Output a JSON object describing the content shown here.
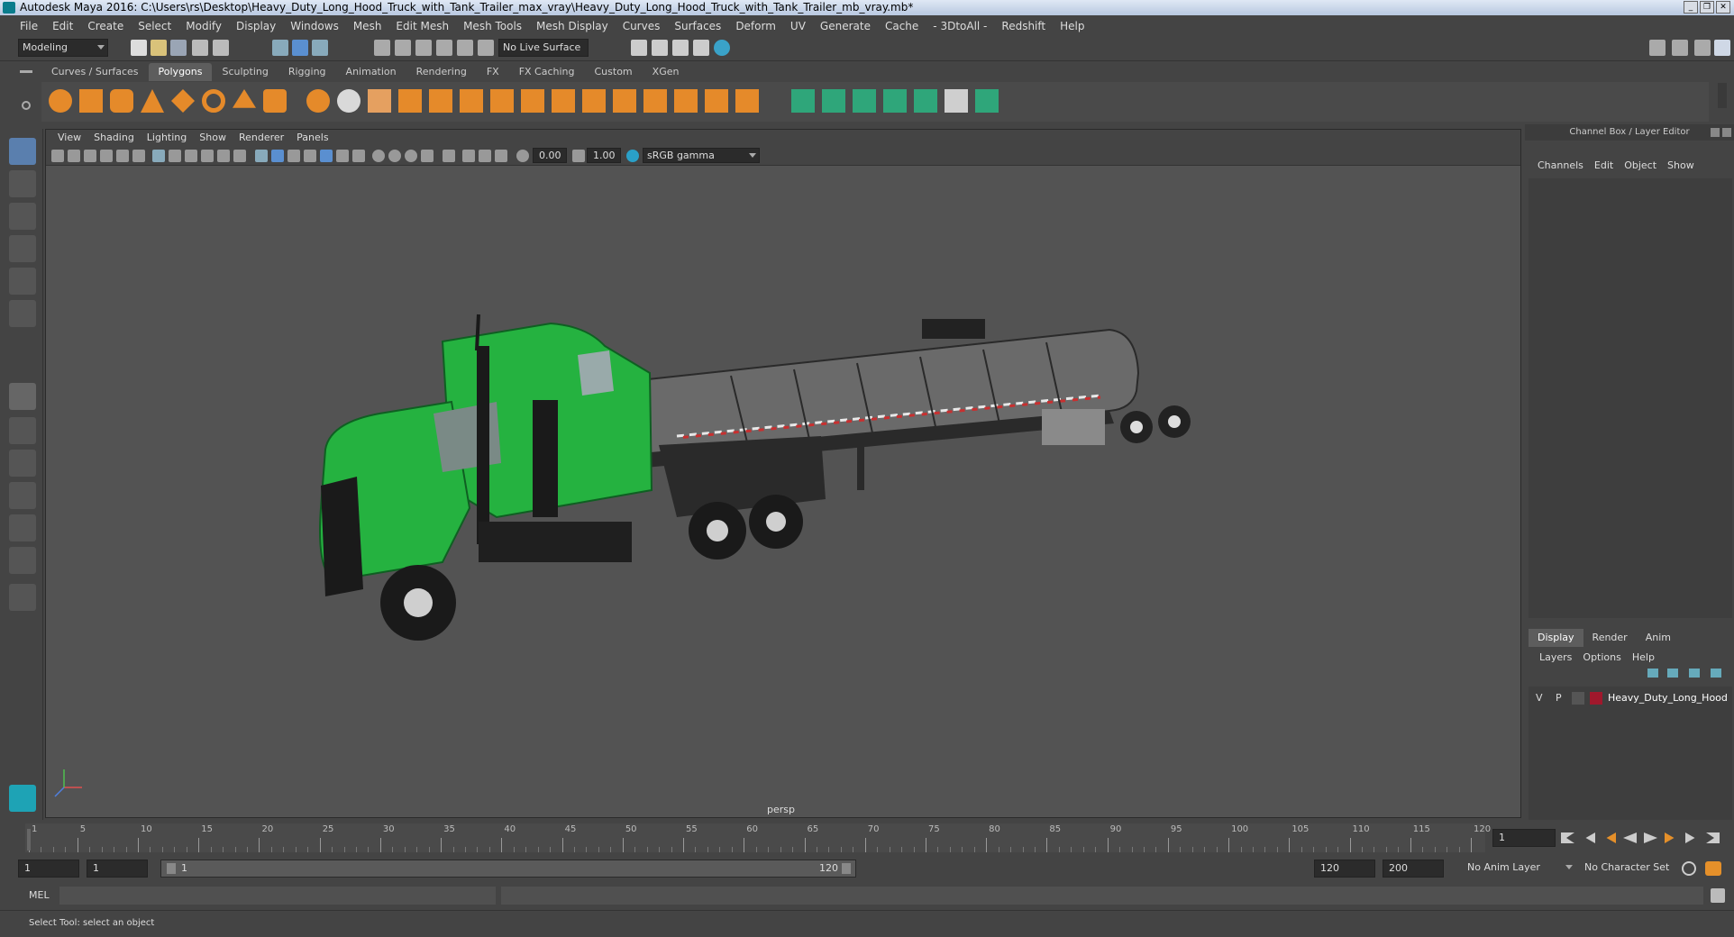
{
  "window": {
    "title": "Autodesk Maya 2016: C:\\Users\\rs\\Desktop\\Heavy_Duty_Long_Hood_Truck_with_Tank_Trailer_max_vray\\Heavy_Duty_Long_Hood_Truck_with_Tank_Trailer_mb_vray.mb*",
    "controls": [
      "_",
      "❐",
      "✕"
    ]
  },
  "menubar": [
    "File",
    "Edit",
    "Create",
    "Select",
    "Modify",
    "Display",
    "Windows",
    "Mesh",
    "Edit Mesh",
    "Mesh Tools",
    "Mesh Display",
    "Curves",
    "Surfaces",
    "Deform",
    "UV",
    "Generate",
    "Cache",
    "- 3DtoAll -",
    "Redshift",
    "Help"
  ],
  "statusline": {
    "mode": "Modeling",
    "live_surface": "No Live Surface"
  },
  "shelf": {
    "tabs": [
      "Curves / Surfaces",
      "Polygons",
      "Sculpting",
      "Rigging",
      "Animation",
      "Rendering",
      "FX",
      "FX Caching",
      "Custom",
      "XGen"
    ],
    "active_tab": "Polygons"
  },
  "viewport": {
    "menu": [
      "View",
      "Shading",
      "Lighting",
      "Show",
      "Renderer",
      "Panels"
    ],
    "exposure": "0.00",
    "gamma": "1.00",
    "color_space": "sRGB gamma",
    "camera_label": "persp"
  },
  "channel_box": {
    "title": "Channel Box / Layer Editor",
    "menu": [
      "Channels",
      "Edit",
      "Object",
      "Show"
    ],
    "layer_tabs": [
      "Display",
      "Render",
      "Anim"
    ],
    "active_layer_tab": "Display",
    "layer_menu": [
      "Layers",
      "Options",
      "Help"
    ],
    "layer": {
      "v": "V",
      "p": "P",
      "name": "Heavy_Duty_Long_Hood",
      "color": "#a0182c"
    }
  },
  "timeline": {
    "ticks": [
      "1",
      "5",
      "10",
      "15",
      "20",
      "25",
      "30",
      "35",
      "40",
      "45",
      "50",
      "55",
      "60",
      "65",
      "70",
      "75",
      "80",
      "85",
      "90",
      "95",
      "100",
      "105",
      "110",
      "115",
      "120"
    ],
    "current_frame": "1"
  },
  "range": {
    "start": "1",
    "playback_start": "1",
    "slider_start": "1",
    "slider_end": "120",
    "playback_end": "120",
    "end": "200",
    "anim_layer": "No Anim Layer",
    "character_set": "No Character Set"
  },
  "cmdline": {
    "label": "MEL"
  },
  "helpline": {
    "text": "Select Tool: select an object"
  },
  "colors": {
    "truck_green": "#25b240",
    "ui_bg": "#444444",
    "viewport_bg": "#535353"
  }
}
